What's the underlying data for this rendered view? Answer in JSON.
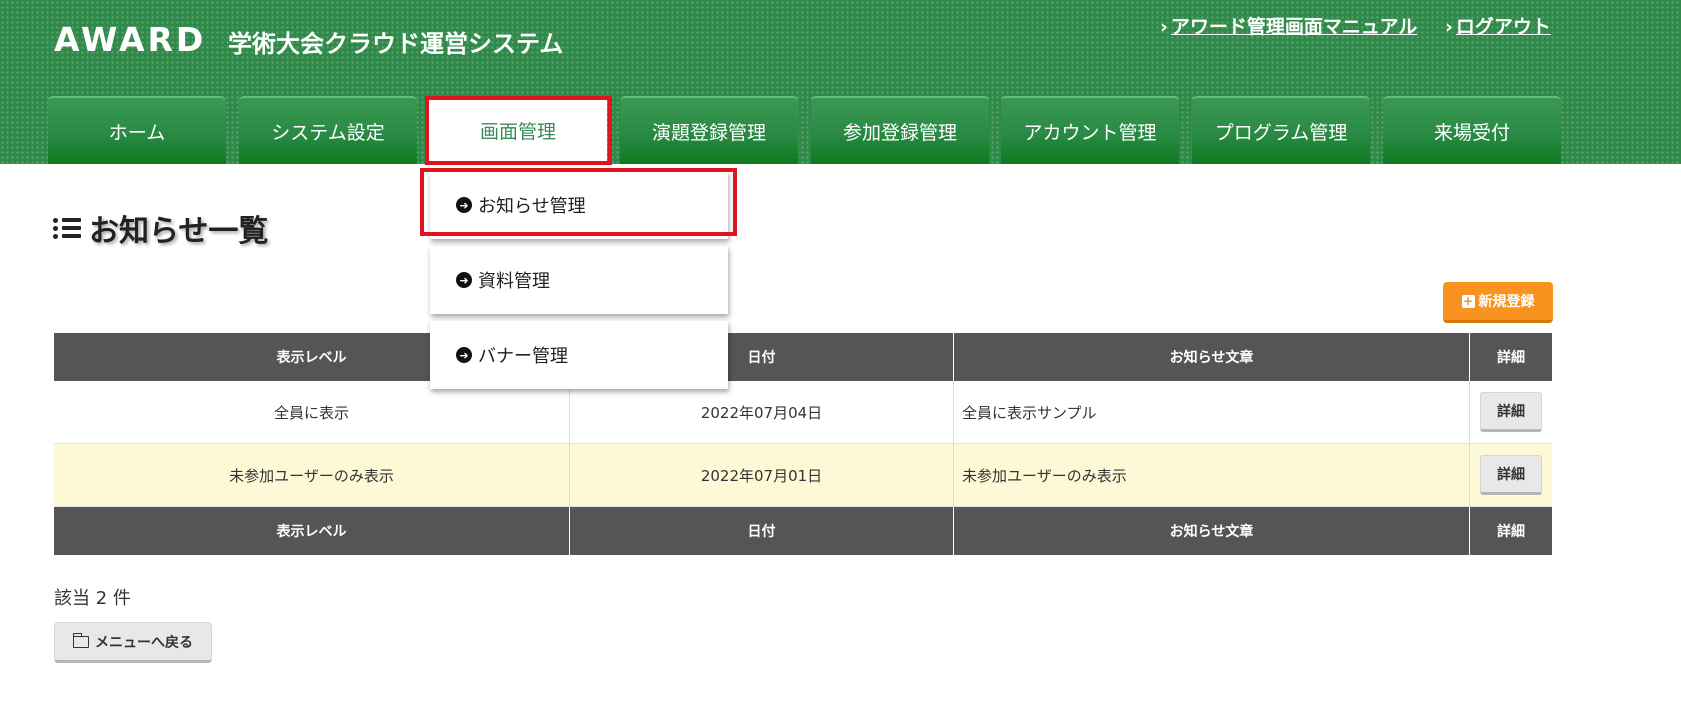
{
  "header": {
    "logo": "AWARD",
    "system_title": "学術大会クラウド運営システム",
    "links": {
      "manual": "アワード管理画面マニュアル",
      "logout": "ログアウト"
    }
  },
  "nav": {
    "tabs": [
      {
        "label": "ホーム"
      },
      {
        "label": "システム設定"
      },
      {
        "label": "画面管理"
      },
      {
        "label": "演題登録管理"
      },
      {
        "label": "参加登録管理"
      },
      {
        "label": "アカウント管理"
      },
      {
        "label": "プログラム管理"
      },
      {
        "label": "来場受付"
      }
    ],
    "active_tab": "画面管理"
  },
  "dropdown": {
    "items": [
      {
        "label": "お知らせ管理"
      },
      {
        "label": "資料管理"
      },
      {
        "label": "バナー管理"
      }
    ],
    "highlighted": "お知らせ管理"
  },
  "page": {
    "title": "お知らせ一覧",
    "new_button": "新規登録"
  },
  "table": {
    "columns": [
      "表示レベル",
      "日付",
      "お知らせ文章",
      "詳細"
    ],
    "rows": [
      {
        "level": "全員に表示",
        "date": "2022年07月04日",
        "text": "全員に表示サンプル",
        "action": "詳細"
      },
      {
        "level": "未参加ユーザーのみ表示",
        "date": "2022年07月01日",
        "text": "未参加ユーザーのみ表示",
        "action": "詳細"
      }
    ]
  },
  "footer": {
    "count_text": "該当 2 件",
    "back_button": "メニューへ戻る"
  },
  "colors": {
    "header_green": "#2f8a4a",
    "highlight_red": "#e0141e",
    "accent_orange": "#f7931e",
    "table_header": "#555555",
    "alt_row": "#fdf9d6"
  }
}
